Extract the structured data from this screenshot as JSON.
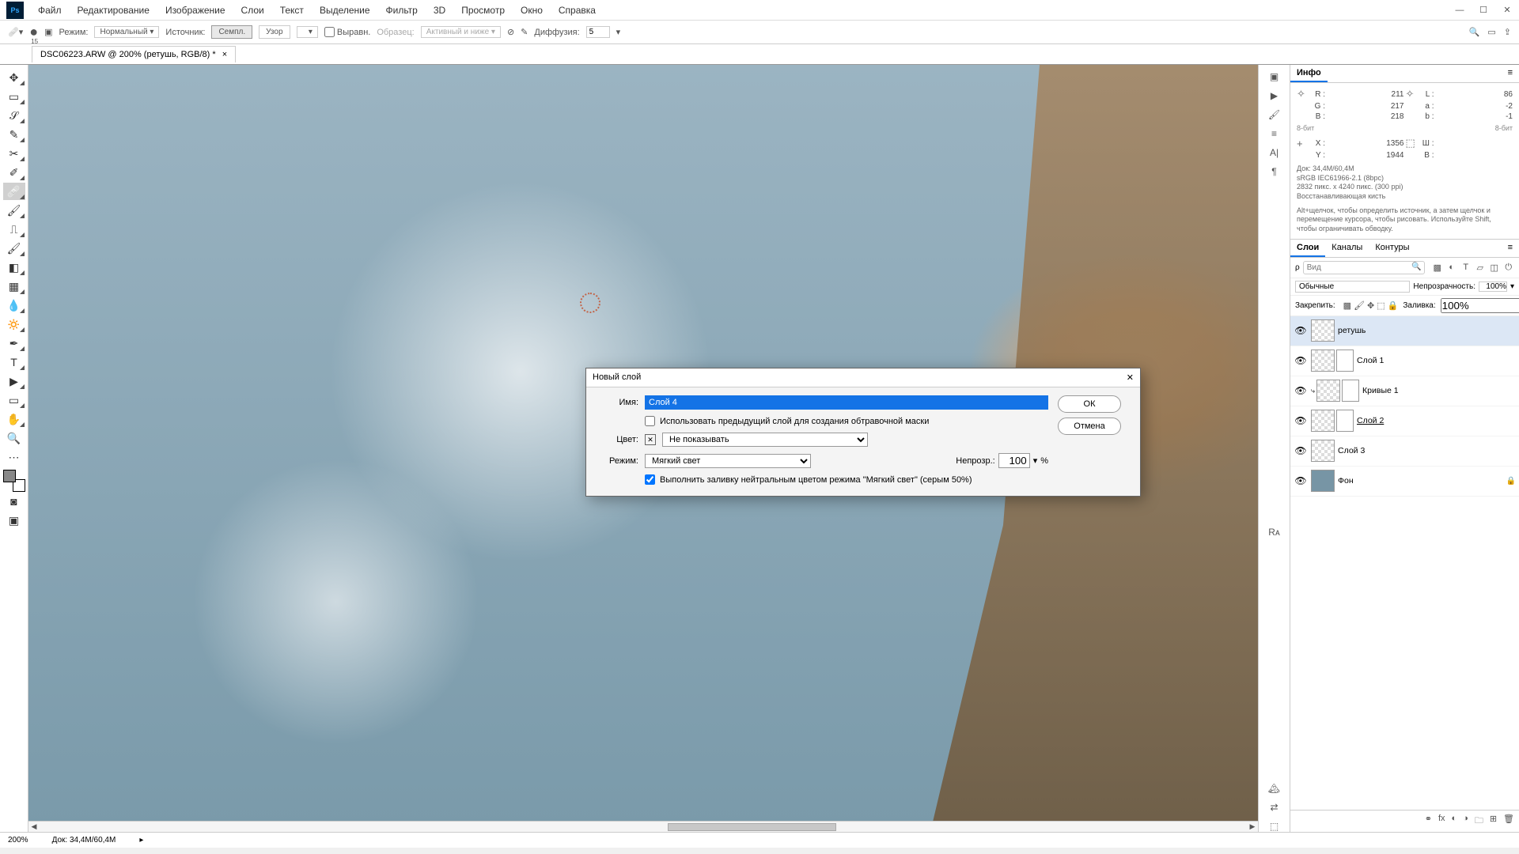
{
  "menu": [
    "Файл",
    "Редактирование",
    "Изображение",
    "Слои",
    "Текст",
    "Выделение",
    "Фильтр",
    "3D",
    "Просмотр",
    "Окно",
    "Справка"
  ],
  "options": {
    "brushSize": "15",
    "modeLabel": "Режим:",
    "mode": "Нормальный",
    "sourceLabel": "Источник:",
    "sampled": "Семпл.",
    "pattern": "Узор",
    "aligned": "Выравн.",
    "sampleLabel": "Образец:",
    "sample": "Активный и ниже",
    "diffLabel": "Диффузия:",
    "diff": "5"
  },
  "doc": {
    "tab": "DSC06223.ARW @ 200% (ретушь, RGB/8) *"
  },
  "info": {
    "tab": "Инфо",
    "R": "211",
    "G": "217",
    "B": "218",
    "L": "86",
    "a": "-2",
    "b": "-1",
    "bit1": "8-бит",
    "bit2": "8-бит",
    "X": "1356",
    "Y": "1944",
    "W": "",
    "H": "",
    "doc": "Док: 34,4M/60,4M",
    "profile": "sRGB IEC61966-2.1 (8bpc)",
    "dims": "2832 пикс. x 4240 пикс. (300 ppi)",
    "tool": "Восстанавливающая кисть",
    "hint": "Alt+щелчок, чтобы определить источник, а затем щелчок и перемещение курсора, чтобы рисовать. Используйте Shift, чтобы ограничивать обводку."
  },
  "layerTabs": {
    "layers": "Слои",
    "channels": "Каналы",
    "paths": "Контуры"
  },
  "layersPanel": {
    "search": "Вид",
    "blend": "Обычные",
    "opacityLabel": "Непрозрачность:",
    "opacity": "100%",
    "lockLabel": "Закрепить:",
    "fillLabel": "Заливка:",
    "fill": "100%"
  },
  "layers": [
    {
      "name": "ретушь",
      "mask": false,
      "sel": true,
      "clip": false,
      "underline": false
    },
    {
      "name": "Слой 1",
      "mask": true,
      "sel": false,
      "clip": false,
      "underline": false
    },
    {
      "name": "Кривые 1",
      "mask": true,
      "sel": false,
      "clip": true,
      "underline": false
    },
    {
      "name": "Слой 2",
      "mask": true,
      "sel": false,
      "clip": false,
      "underline": true
    },
    {
      "name": "Слой 3",
      "mask": false,
      "sel": false,
      "clip": false,
      "underline": false
    },
    {
      "name": "Фон",
      "mask": false,
      "sel": false,
      "bg": true,
      "locked": true
    }
  ],
  "dialog": {
    "title": "Новый слой",
    "nameLabel": "Имя:",
    "name": "Слой 4",
    "clip": "Использовать предыдущий слой для создания обтравочной маски",
    "colorLabel": "Цвет:",
    "color": "Не показывать",
    "modeLabel": "Режим:",
    "mode": "Мягкий свет",
    "opLabel": "Непрозр.:",
    "op": "100",
    "pct": "%",
    "fill": "Выполнить заливку нейтральным цветом режима \"Мягкий свет\"  (серым 50%)",
    "ok": "ОК",
    "cancel": "Отмена"
  },
  "status": {
    "zoom": "200%",
    "doc": "Док: 34,4M/60,4M"
  }
}
